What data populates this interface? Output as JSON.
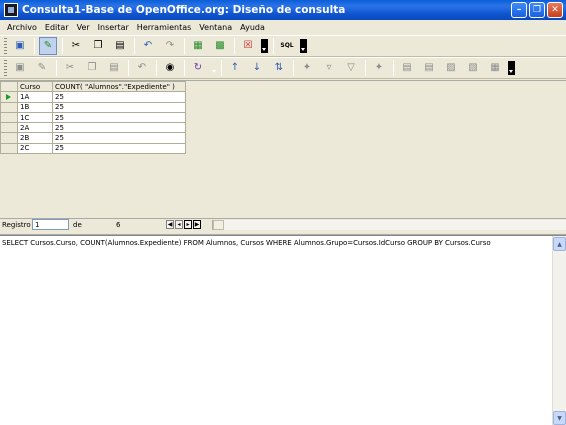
{
  "window": {
    "title": "Consulta1-Base de OpenOffice.org: Diseño de consulta",
    "minimize_icon": "minimize-icon",
    "maximize_icon": "restore-icon",
    "close_icon": "close-icon"
  },
  "menu": [
    {
      "label": "Archivo",
      "name": "menu-archivo"
    },
    {
      "label": "Editar",
      "name": "menu-editar"
    },
    {
      "label": "Ver",
      "name": "menu-ver"
    },
    {
      "label": "Insertar",
      "name": "menu-insertar"
    },
    {
      "label": "Herramientas",
      "name": "menu-herramientas"
    },
    {
      "label": "Ventana",
      "name": "menu-ventana"
    },
    {
      "label": "Ayuda",
      "name": "menu-ayuda"
    }
  ],
  "toolbar1": {
    "sql_label": "SQL"
  },
  "grid": {
    "headers": [
      "Curso",
      "COUNT( \"Alumnos\".\"Expediente\" )"
    ],
    "rows": [
      [
        "1A",
        "25"
      ],
      [
        "1B",
        "25"
      ],
      [
        "1C",
        "25"
      ],
      [
        "2A",
        "25"
      ],
      [
        "2B",
        "25"
      ],
      [
        "2C",
        "25"
      ]
    ],
    "current_row_marker": "current-row-arrow-icon"
  },
  "record_nav": {
    "label": "Registro",
    "current": "1",
    "of_label": "de",
    "total": "6"
  },
  "sql": {
    "query": "SELECT Cursos.Curso, COUNT(Alumnos.Expediente) FROM Alumnos, Cursos WHERE Alumnos.Grupo=Cursos.IdCurso GROUP BY Cursos.Curso"
  },
  "colors": {
    "titlebar": "#0a5fd8",
    "chrome": "#ece9d8",
    "current_row_arrow": "#1c9c2a"
  }
}
